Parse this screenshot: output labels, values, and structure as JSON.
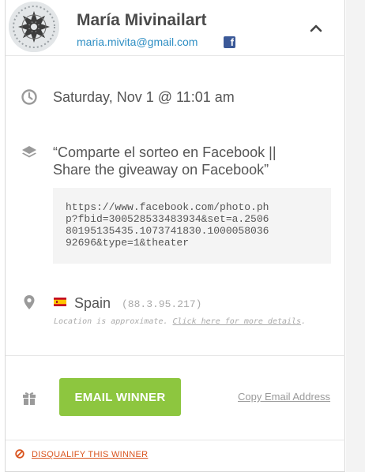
{
  "winner": {
    "name": "María Mivinailart",
    "email": "maria.mivita@gmail.com",
    "social_icon": "facebook-icon"
  },
  "entry": {
    "date": "Saturday, Nov 1 @ 11:01 am",
    "action_title": "“Comparte el sorteo en Facebook || Share the giveaway on Facebook”",
    "submitted_url": "https://www.facebook.com/photo.ph\np?fbid=300528533483934&set=a.2506\n80195135435.1073741830.1000058036\n92696&type=1&theater"
  },
  "location": {
    "country": "Spain",
    "ip": "(88.3.95.217)",
    "note_prefix": "Location is approximate. ",
    "note_link": "Click here for more details",
    "note_suffix": "."
  },
  "actions": {
    "email_button": "EMAIL WINNER",
    "copy_email": "Copy Email Address",
    "disqualify": "DISQUALIFY THIS WINNER"
  },
  "colors": {
    "accent_green": "#8dc63f",
    "link_blue": "#2f8fc4",
    "danger_orange": "#d9541e"
  }
}
